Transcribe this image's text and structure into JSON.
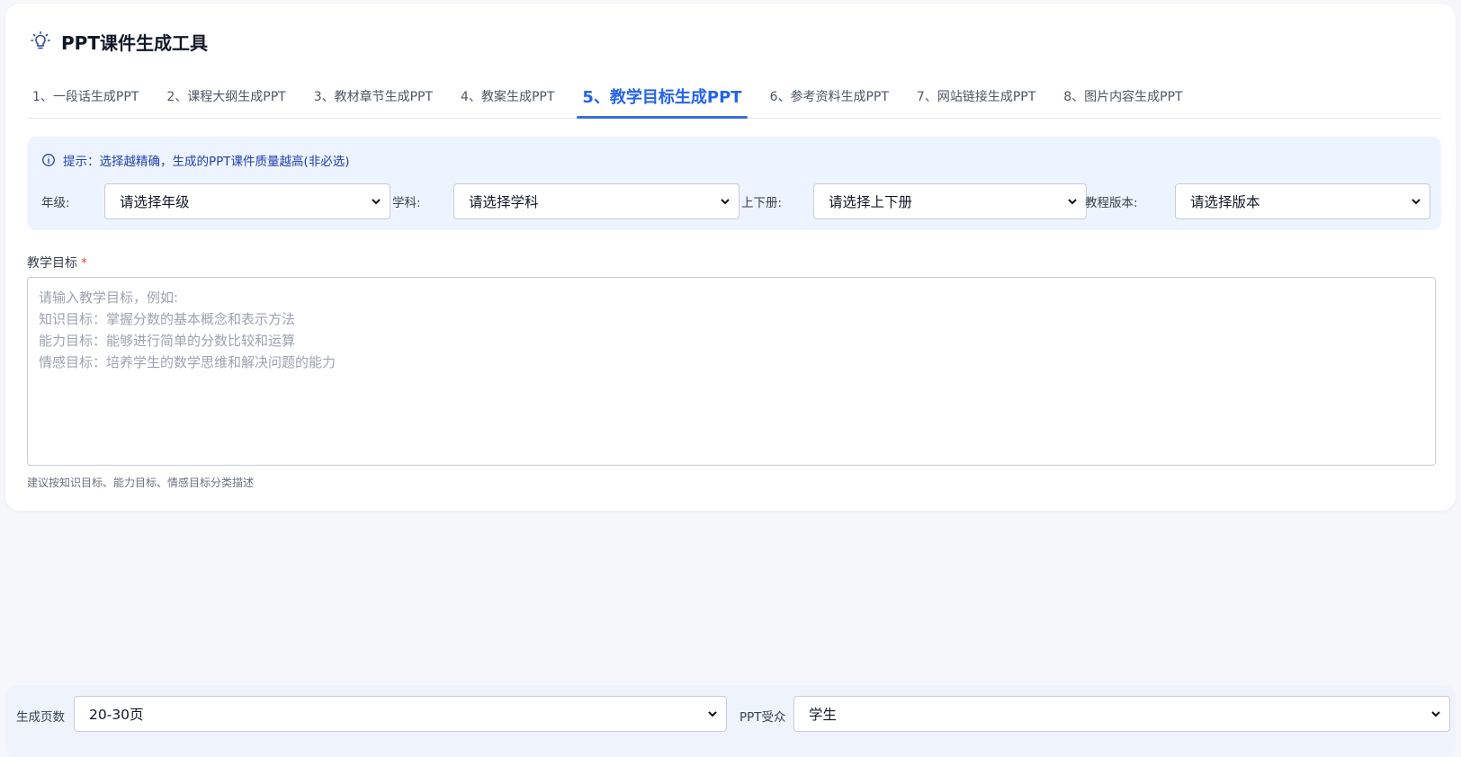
{
  "app": {
    "title": "PPT课件生成工具",
    "icon": "lightbulb-icon",
    "accent_color": "#2563eb"
  },
  "tabs": [
    {
      "label": "1、一段话生成PPT",
      "active": false
    },
    {
      "label": "2、课程大纲生成PPT",
      "active": false
    },
    {
      "label": "3、教材章节生成PPT",
      "active": false
    },
    {
      "label": "4、教案生成PPT",
      "active": false
    },
    {
      "label": "5、教学目标生成PPT",
      "active": true
    },
    {
      "label": "6、参考资料生成PPT",
      "active": false
    },
    {
      "label": "7、网站链接生成PPT",
      "active": false
    },
    {
      "label": "8、图片内容生成PPT",
      "active": false
    }
  ],
  "hint": {
    "icon": "info-icon",
    "text": "提示：选择越精确，生成的PPT课件质量越高(非必选)"
  },
  "filters": {
    "grade": {
      "label": "年级:",
      "value": "请选择年级"
    },
    "subject": {
      "label": "学科:",
      "value": "请选择学科"
    },
    "volume": {
      "label": "上下册:",
      "value": "请选择上下册"
    },
    "edition": {
      "label": "教程版本:",
      "value": "请选择版本"
    }
  },
  "objectives": {
    "label": "教学目标",
    "required_mark": "*",
    "placeholder_lines": [
      "请输入教学目标，例如:",
      "知识目标：掌握分数的基本概念和表示方法",
      "能力目标：能够进行简单的分数比较和运算",
      "情感目标：培养学生的数学思维和解决问题的能力"
    ],
    "helper": "建议按知识目标、能力目标、情感目标分类描述"
  },
  "bottom": {
    "pages": {
      "label": "生成页数",
      "value": "20-30页"
    },
    "audience": {
      "label": "PPT受众",
      "value": "学生"
    }
  }
}
